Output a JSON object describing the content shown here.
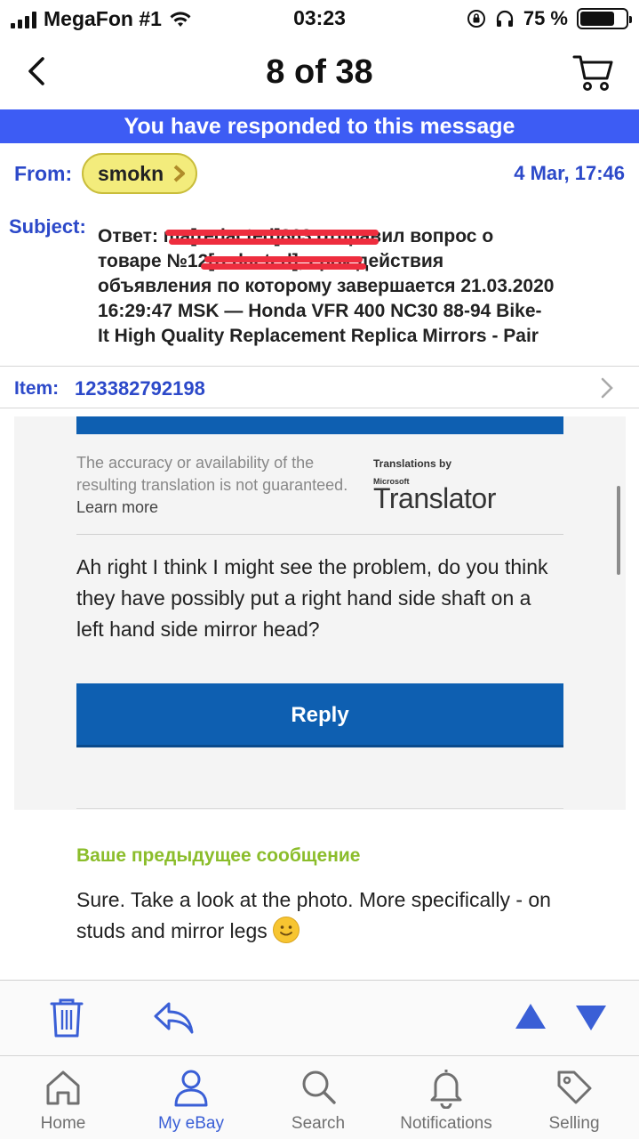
{
  "status_bar": {
    "carrier": "MegaFon #1",
    "time": "03:23",
    "battery": "75 %",
    "battery_level": 0.75
  },
  "nav": {
    "title": "8 of 38"
  },
  "banner": {
    "text": "You have responded to this message"
  },
  "header": {
    "from_label": "From:",
    "sender": "smokn",
    "date": "4 Mar, 17:46",
    "subject_label": "Subject:",
    "subject_lines": [
      "Ответ: ma[redacted]863 отправил вопрос о",
      "товаре №12[redacted], срок действия",
      "объявления по которому завершается 21.03.2020",
      "16:29:47 MSK — Honda VFR 400 NC30 88-94 Bike-",
      "It High Quality Replacement Replica Mirrors - Pair"
    ],
    "item_label": "Item:",
    "item_number": "123382792198"
  },
  "message": {
    "disclaimer": "The accuracy or availability of the resulting translation is not guaranteed.",
    "learn_more": "Learn more",
    "translator_by": "Translations by",
    "translator_brand": "Microsoft",
    "translator_name": "Translator",
    "body": "Ah right I think I might see the problem, do you think they have possibly put a right hand side shaft on a left hand side mirror head?",
    "reply_label": "Reply"
  },
  "previous": {
    "heading": "Ваше предыдущее сообщение",
    "body": "Sure. Take a look at the photo. More specifically - on studs and mirror legs"
  },
  "tabs": [
    {
      "label": "Home",
      "icon": "home-icon"
    },
    {
      "label": "My eBay",
      "icon": "user-icon"
    },
    {
      "label": "Search",
      "icon": "search-icon"
    },
    {
      "label": "Notifications",
      "icon": "bell-icon"
    },
    {
      "label": "Selling",
      "icon": "tag-icon"
    }
  ],
  "colors": {
    "accent": "#3d5cf4",
    "link": "#2c49c9",
    "button": "#0e5fb1",
    "previous_heading": "#8bbd2b",
    "sender_chip": "#f3ec7c"
  }
}
